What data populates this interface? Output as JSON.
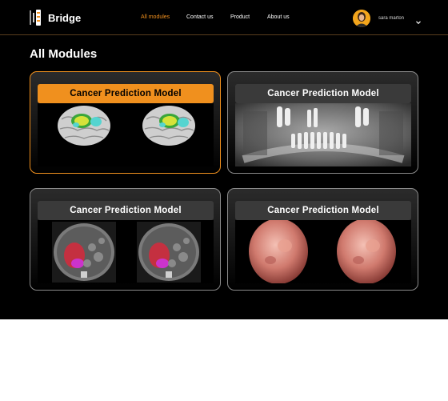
{
  "brand": {
    "name": "Bridge"
  },
  "nav": [
    {
      "label": "All modules",
      "active": true
    },
    {
      "label": "Contact us",
      "active": false
    },
    {
      "label": "Product",
      "active": false
    },
    {
      "label": "About us",
      "active": false
    }
  ],
  "user": {
    "name": "sara marton"
  },
  "page": {
    "title": "All Modules"
  },
  "modules": [
    {
      "title": "Cancer Prediction Model",
      "selected": true,
      "image": "brain-mri"
    },
    {
      "title": "Cancer Prediction Model",
      "selected": false,
      "image": "dental-xray"
    },
    {
      "title": "Cancer Prediction Model",
      "selected": false,
      "image": "abdominal-ct"
    },
    {
      "title": "Cancer Prediction Model",
      "selected": false,
      "image": "endoscopy"
    }
  ],
  "colors": {
    "accent": "#f0901e",
    "background": "#000000",
    "card_header": "#3a3a3a"
  }
}
